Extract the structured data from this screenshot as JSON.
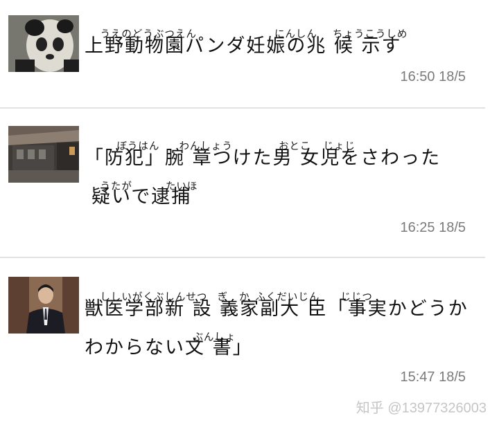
{
  "items": [
    {
      "ruby": [
        "うえのどうぶつえん",
        "にんしん",
        "ちょうこうしめ"
      ],
      "lines": [
        "上野動物園パンダ妊娠の兆 候 示す"
      ],
      "time": "16:50 18/5",
      "thumb_icon": "panda-photo"
    },
    {
      "ruby": [
        "ぼうはん",
        "わんしょう",
        "おとこ",
        "じょじ"
      ],
      "lines": [
        "「防犯」腕 章つけた男 女児をさわった"
      ],
      "ruby2": [
        "うたが",
        "たいほ"
      ],
      "lines2": [
        "疑いで逮捕"
      ],
      "time": "16:25 18/5",
      "thumb_icon": "building-photo"
    },
    {
      "ruby": [
        "ししいがくぶしんせつ",
        "ぎ",
        "か",
        "ふくだいじん",
        "じじつ"
      ],
      "lines": [
        "獣医学部新 設 義家副大 臣「事実かどうか"
      ],
      "ruby2": [
        "ぶんしょ"
      ],
      "lines2": [
        "わからない文 書」"
      ],
      "time": "15:47 18/5",
      "thumb_icon": "person-photo"
    }
  ],
  "watermark": "知乎 @13977326003"
}
